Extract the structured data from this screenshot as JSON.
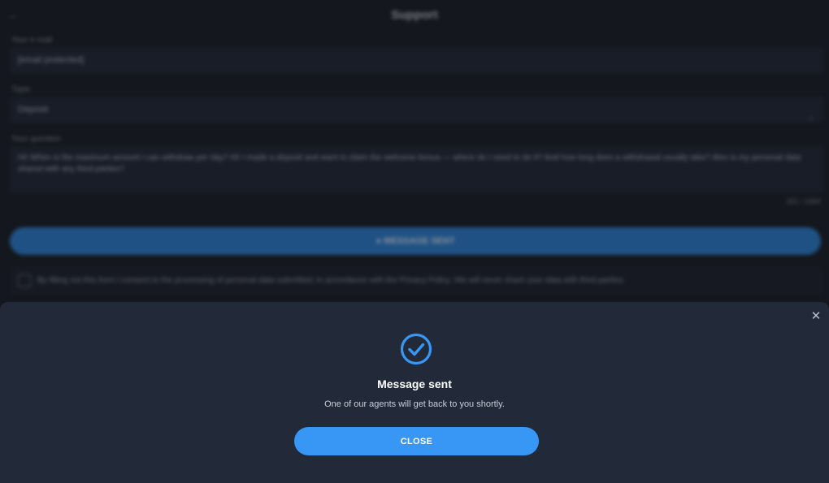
{
  "background": {
    "title": "Support",
    "email_label": "Your e-mail",
    "email_value": "[email protected]",
    "topic_label": "Topic",
    "topic_value": "Deposit",
    "question_label": "Your question",
    "question_value": "Hi! When is the maximum amount I can withdraw per day? Hi! I made a deposit and want to claim the welcome bonus — where do I need to do it? And how long does a withdrawal usually take? Also is my personal data shared with any third parties?",
    "counter": "221 / 1000",
    "send_label": "MESSAGE SENT",
    "consent_text": "By filling out this form I consent to the processing of personal data submitted, in accordance with the Privacy Policy. We will never share your data with third parties."
  },
  "modal": {
    "title": "Message sent",
    "message": "One of our agents will get back to you shortly.",
    "close_label": "CLOSE",
    "success_icon": "check-circle-icon",
    "dismiss_icon": "close-icon",
    "accent_color": "#3897f5"
  }
}
